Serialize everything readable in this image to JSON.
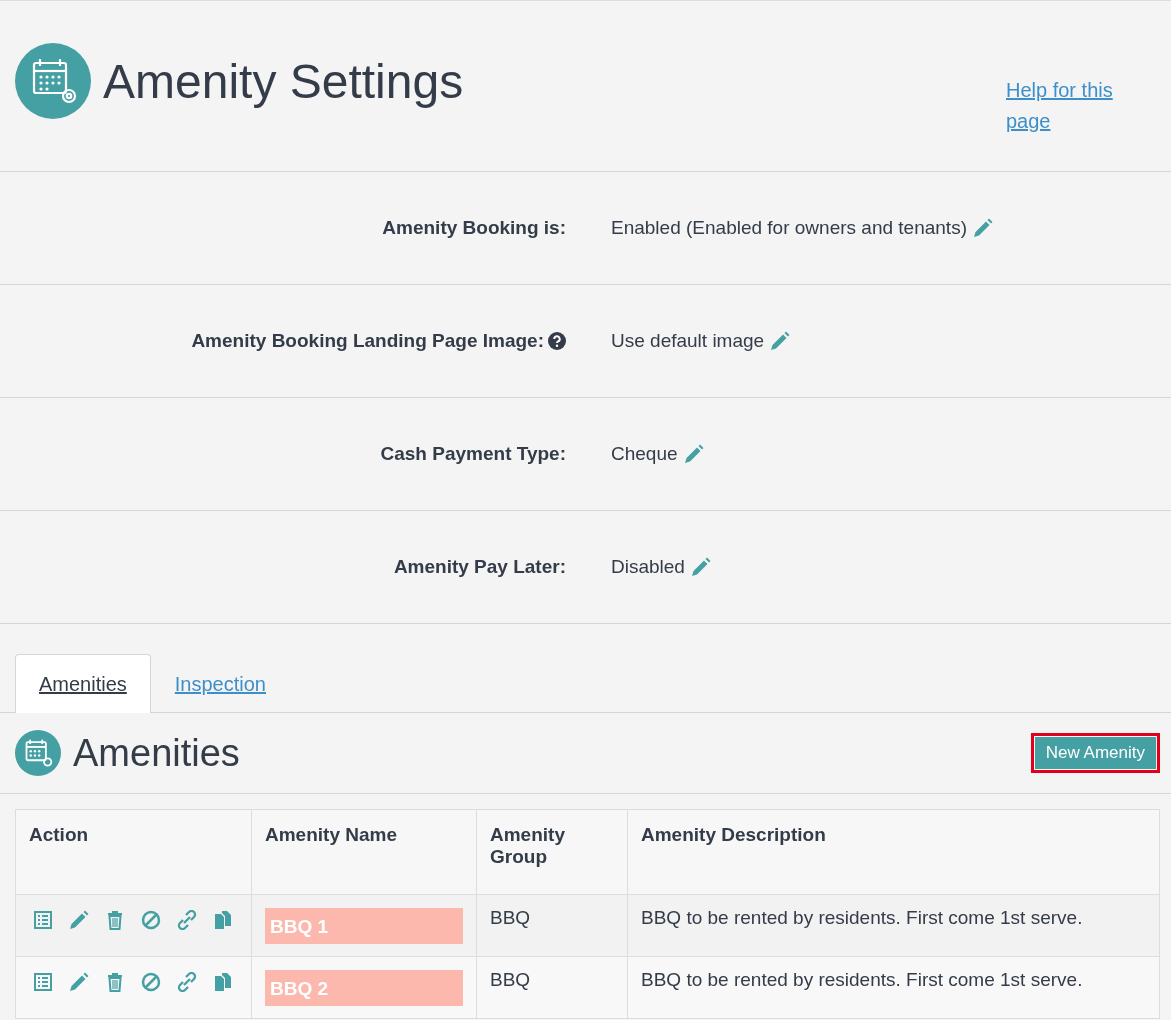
{
  "page": {
    "title": "Amenity Settings",
    "help_link": "Help for this page"
  },
  "settings": [
    {
      "label": "Amenity Booking is:",
      "help": false,
      "value": "Enabled (Enabled for owners and tenants)"
    },
    {
      "label": "Amenity Booking Landing Page Image:",
      "help": true,
      "value": "Use default image"
    },
    {
      "label": "Cash Payment Type:",
      "help": false,
      "value": "Cheque"
    },
    {
      "label": "Amenity Pay Later:",
      "help": false,
      "value": "Disabled"
    }
  ],
  "tabs": [
    {
      "label": "Amenities",
      "selected": true
    },
    {
      "label": "Inspection",
      "selected": false
    }
  ],
  "section": {
    "title": "Amenities",
    "button": {
      "label": "New Amenity",
      "highlighted": true
    }
  },
  "table": {
    "columns": [
      "Action",
      "Amenity Name",
      "Amenity Group",
      "Amenity Description"
    ],
    "rows": [
      {
        "name": "BBQ 1",
        "group": "BBQ",
        "description": "BBQ to be rented by residents. First come 1st serve."
      },
      {
        "name": "BBQ 2",
        "group": "BBQ",
        "description": "BBQ to be rented by residents. First come 1st serve."
      }
    ]
  }
}
